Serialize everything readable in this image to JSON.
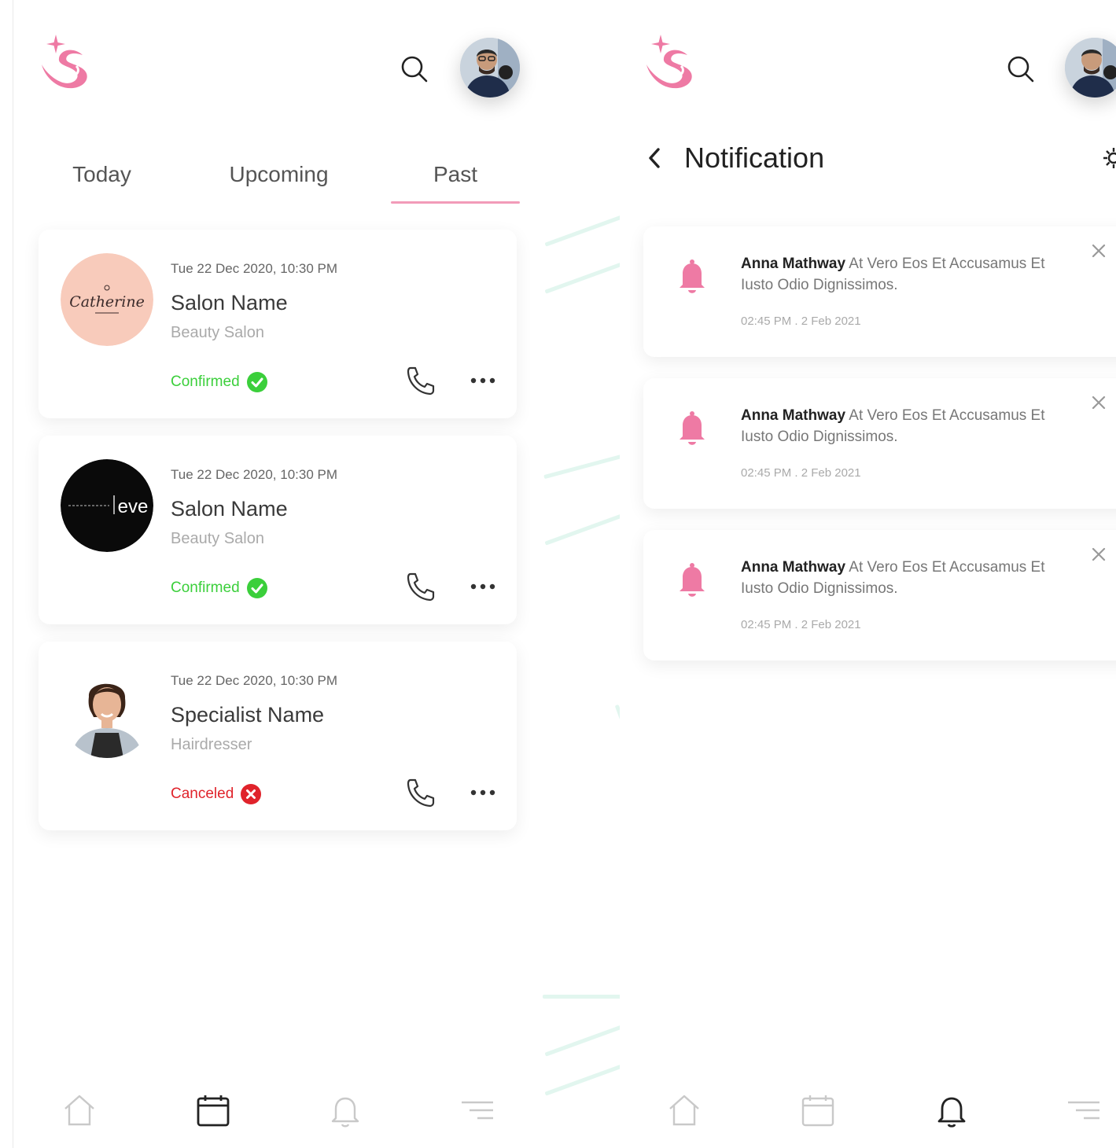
{
  "colors": {
    "brand_pink": "#ee7aa4",
    "confirmed": "#3bcf3b",
    "canceled": "#e0232b",
    "tab_underline": "#f29bb9"
  },
  "appointments_screen": {
    "tabs": [
      {
        "label": "Today"
      },
      {
        "label": "Upcoming"
      },
      {
        "label": "Past"
      }
    ],
    "active_tab": "Past",
    "cards": [
      {
        "date": "Tue 22 Dec 2020, 10:30 PM",
        "name": "Salon Name",
        "type": "Beauty Salon",
        "status": "Confirmed",
        "logo_text": "Catherine",
        "status_icon": "check-circle-icon"
      },
      {
        "date": "Tue 22 Dec 2020, 10:30 PM",
        "name": "Salon Name",
        "type": "Beauty Salon",
        "status": "Confirmed",
        "logo_text": "eve",
        "status_icon": "check-circle-icon"
      },
      {
        "date": "Tue 22 Dec 2020, 10:30 PM",
        "name": "Specialist Name",
        "type": "Hairdresser",
        "status": "Canceled",
        "status_icon": "x-circle-icon"
      }
    ],
    "bottom_nav": {
      "items": [
        "home-icon",
        "calendar-icon",
        "bell-icon",
        "menu-icon"
      ],
      "active": "calendar-icon"
    }
  },
  "notifications_screen": {
    "title": "Notification",
    "items": [
      {
        "sender": "Anna Mathway",
        "message": "At Vero Eos Et Accusamus Et Iusto Odio Dignissimos.",
        "time": "02:45 PM . 2 Feb 2021"
      },
      {
        "sender": "Anna Mathway",
        "message": "At Vero Eos Et Accusamus Et Iusto Odio Dignissimos.",
        "time": "02:45 PM . 2 Feb 2021"
      },
      {
        "sender": "Anna Mathway",
        "message": "At Vero Eos Et Accusamus Et Iusto Odio Dignissimos.",
        "time": "02:45 PM . 2 Feb 2021"
      }
    ],
    "bottom_nav": {
      "items": [
        "home-icon",
        "calendar-icon",
        "bell-icon",
        "menu-icon"
      ],
      "active": "bell-icon"
    }
  }
}
